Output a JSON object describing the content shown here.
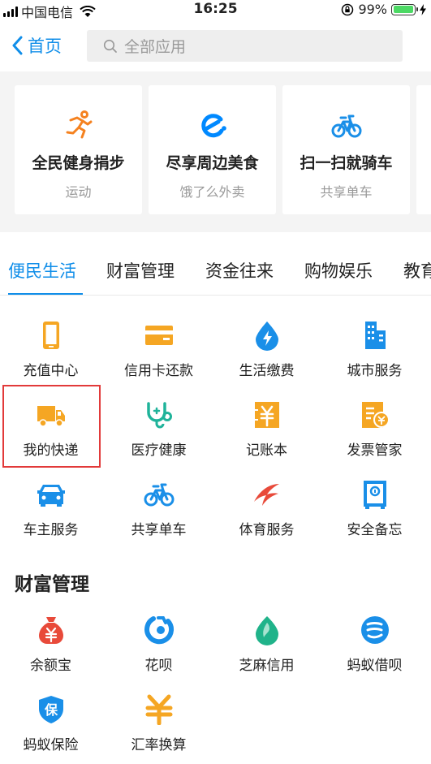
{
  "status_bar": {
    "carrier": "中国电信",
    "time": "16:25",
    "battery": "99%",
    "battery_level": 0.99
  },
  "nav": {
    "back_label": "首页",
    "search_placeholder": "全部应用"
  },
  "cards": [
    {
      "title": "全民健身捐步",
      "sub": "运动",
      "icon": "running-man-icon",
      "color": "#f58220"
    },
    {
      "title": "尽享周边美食",
      "sub": "饿了么外卖",
      "icon": "eleme-icon",
      "color": "#0089ff"
    },
    {
      "title": "扫一扫就骑车",
      "sub": "共享单车",
      "icon": "bicycle-icon",
      "color": "#1a8fe8"
    }
  ],
  "tabs": [
    "便民生活",
    "财富管理",
    "资金往来",
    "购物娱乐",
    "教育"
  ],
  "grid": [
    {
      "label": "充值中心",
      "icon": "phone-icon",
      "color": "#f5a623"
    },
    {
      "label": "信用卡还款",
      "icon": "credit-card-icon",
      "color": "#f5a623"
    },
    {
      "label": "生活缴费",
      "icon": "lightning-drop-icon",
      "color": "#1a8fe8"
    },
    {
      "label": "城市服务",
      "icon": "city-building-icon",
      "color": "#1a8fe8"
    },
    {
      "label": "我的快递",
      "icon": "delivery-truck-icon",
      "color": "#f5a623"
    },
    {
      "label": "医疗健康",
      "icon": "stethoscope-icon",
      "color": "#1fb39a"
    },
    {
      "label": "记账本",
      "icon": "yen-ledger-icon",
      "color": "#f5a623"
    },
    {
      "label": "发票管家",
      "icon": "invoice-icon",
      "color": "#f5a623"
    },
    {
      "label": "车主服务",
      "icon": "car-icon",
      "color": "#1a8fe8"
    },
    {
      "label": "共享单车",
      "icon": "bicycle-icon",
      "color": "#1a8fe8"
    },
    {
      "label": "体育服务",
      "icon": "sport-swoosh-icon",
      "color": "#e84a3a"
    },
    {
      "label": "安全备忘",
      "icon": "safe-icon",
      "color": "#1a8fe8"
    }
  ],
  "wealth": {
    "title": "财富管理",
    "items": [
      {
        "label": "余额宝",
        "icon": "money-bag-icon",
        "color": "#e84a3a"
      },
      {
        "label": "花呗",
        "icon": "huabei-icon",
        "color": "#1a8fe8"
      },
      {
        "label": "芝麻信用",
        "icon": "sesame-icon",
        "color": "#20b38a"
      },
      {
        "label": "蚂蚁借呗",
        "icon": "jiebei-icon",
        "color": "#1a8fe8"
      },
      {
        "label": "蚂蚁保险",
        "icon": "insurance-shield-icon",
        "color": "#1a8fe8"
      },
      {
        "label": "汇率换算",
        "icon": "yen-symbol-icon",
        "color": "#f5a623"
      }
    ]
  }
}
